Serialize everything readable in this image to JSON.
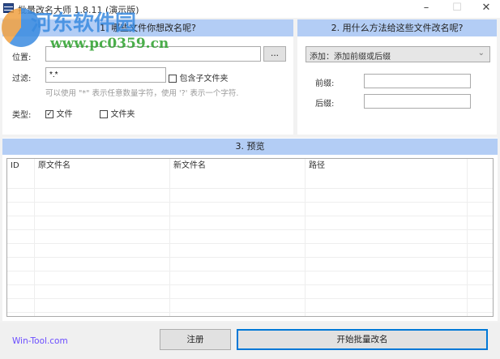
{
  "window": {
    "title": "批量改名大师 1.8.11 (演示版)",
    "minimize": "–",
    "maximize": "☐",
    "close": "✕"
  },
  "watermark": {
    "name": "河东软件园",
    "url": "www.pc0359.cn"
  },
  "section1": {
    "header": "1. 哪些文件你想改名呢?",
    "location_label": "位置:",
    "location_value": "",
    "browse_button": "...",
    "filter_label": "过滤:",
    "filter_value": "*.*",
    "include_subfolders_label": "包含子文件夹",
    "include_subfolders_checked": false,
    "hint": "可以使用 \"*\" 表示任意数量字符，使用 '?' 表示一个字符.",
    "type_label": "类型:",
    "type_file_label": "文件",
    "type_file_checked": true,
    "type_folder_label": "文件夹",
    "type_folder_checked": false
  },
  "section2": {
    "header": "2. 用什么方法给这些文件改名呢?",
    "method_selected": "添加：添加前缀或后缀",
    "prefix_label": "前缀:",
    "prefix_value": "",
    "suffix_label": "后缀:",
    "suffix_value": ""
  },
  "section3": {
    "header": "3. 预览",
    "columns": [
      "ID",
      "原文件名",
      "新文件名",
      "路径"
    ],
    "rows": []
  },
  "footer": {
    "link": "Win-Tool.com",
    "register_button": "注册",
    "start_button": "开始批量改名"
  }
}
